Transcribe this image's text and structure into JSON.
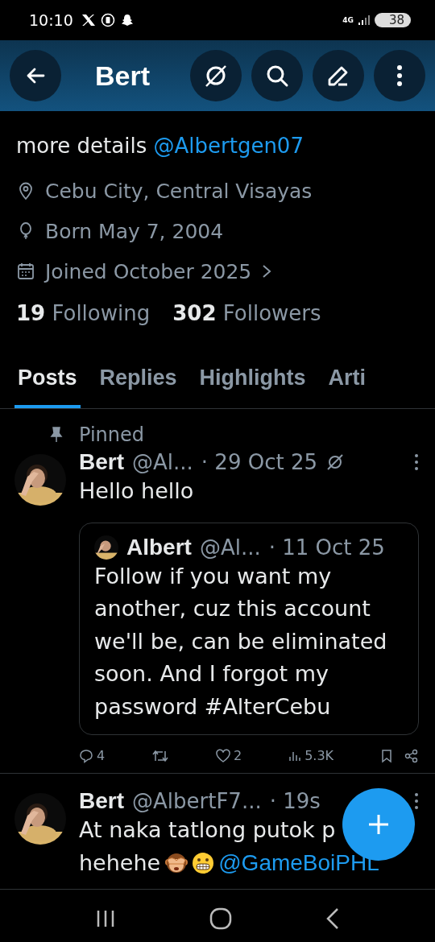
{
  "status_bar": {
    "time": "10:10",
    "network": "4G",
    "battery": "38"
  },
  "header": {
    "title": "Bert"
  },
  "bio": {
    "text": "more details",
    "mention": "@Albertgen07"
  },
  "meta": [
    {
      "kind": "location",
      "text": "Cebu City, Central Visayas"
    },
    {
      "kind": "birthday",
      "text": "Born May 7, 2004"
    },
    {
      "kind": "joined",
      "text": "Joined October 2025"
    }
  ],
  "stats": [
    {
      "count": "19",
      "label": "Following"
    },
    {
      "count": "302",
      "label": "Followers"
    }
  ],
  "tabs": [
    {
      "label": "Posts",
      "selected": true
    },
    {
      "label": "Replies",
      "selected": false
    },
    {
      "label": "Highlights",
      "selected": false
    },
    {
      "label": "Arti",
      "selected": false
    }
  ],
  "posts": [
    {
      "pinned": true,
      "pinned_label": "Pinned",
      "name": "Bert",
      "handle": "@Al...",
      "time": "· 29 Oct 25",
      "text": "Hello hello",
      "quote": {
        "name": "Albert",
        "handle": "@Al...",
        "time": "· 11 Oct 25",
        "text": "Follow if you want my another, cuz this account we'll be, can be eliminated soon. And I forgot my password #AlterCebu"
      },
      "actions": {
        "replies": "4",
        "likes": "2",
        "views": "5.3K"
      }
    },
    {
      "pinned": false,
      "name": "Bert",
      "handle": "@AlbertF7...",
      "time": "· 19s",
      "text": "At naka tatlong putok p",
      "text2": "hehehe",
      "mention": "@GameBoiPHL"
    }
  ]
}
